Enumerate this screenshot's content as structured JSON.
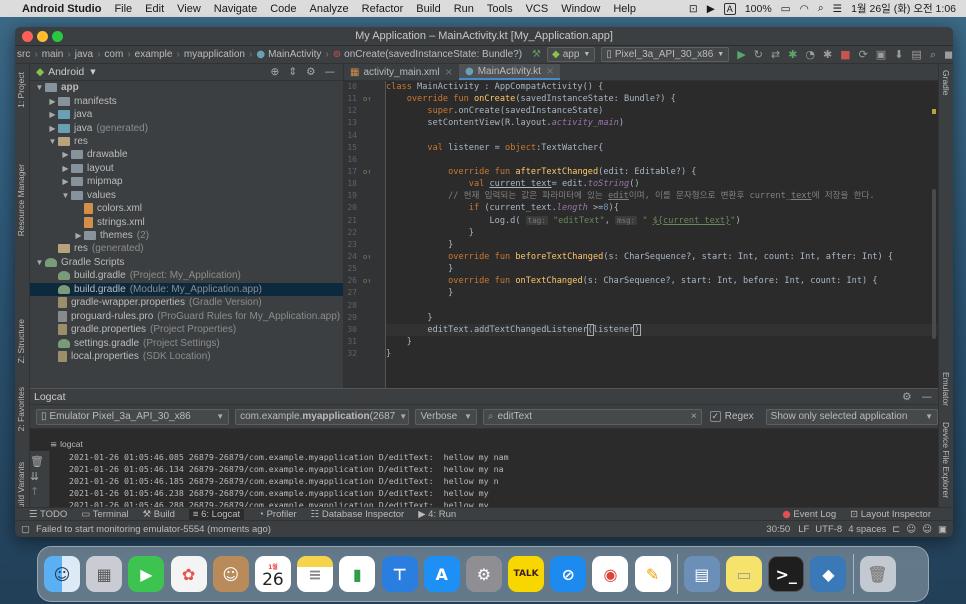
{
  "menubar": {
    "app_name": "Android Studio",
    "items": [
      "File",
      "Edit",
      "View",
      "Navigate",
      "Code",
      "Analyze",
      "Refactor",
      "Build",
      "Run",
      "Tools",
      "VCS",
      "Window",
      "Help"
    ],
    "battery": "100%",
    "keyboard": "A",
    "datetime": "1월 26일 (화) 오전 1:06"
  },
  "window": {
    "title": "My Application – MainActivity.kt [My_Application.app]"
  },
  "navbar": {
    "breadcrumbs": [
      "src",
      "main",
      "java",
      "com",
      "example",
      "myapplication",
      "MainActivity",
      "onCreate(savedInstanceState: Bundle?)"
    ],
    "run_config": "app",
    "device": "Pixel_3a_API_30_x86"
  },
  "project": {
    "view_mode": "Android",
    "tree": [
      {
        "label": "app",
        "hint": "",
        "indent": 0,
        "arrow": "▼",
        "icon": "folder",
        "color": "#87939a",
        "bold": true
      },
      {
        "label": "manifests",
        "hint": "",
        "indent": 1,
        "arrow": "▶",
        "icon": "folder",
        "color": "#87939a"
      },
      {
        "label": "java",
        "hint": "",
        "indent": 1,
        "arrow": "▶",
        "icon": "folder",
        "color": "#6a9fb5"
      },
      {
        "label": "java",
        "hint": "(generated)",
        "indent": 1,
        "arrow": "▶",
        "icon": "folder",
        "color": "#6a9fb5"
      },
      {
        "label": "res",
        "hint": "",
        "indent": 1,
        "arrow": "▼",
        "icon": "folder",
        "color": "#b8a27d"
      },
      {
        "label": "drawable",
        "hint": "",
        "indent": 2,
        "arrow": "▶",
        "icon": "folder",
        "color": "#87939a"
      },
      {
        "label": "layout",
        "hint": "",
        "indent": 2,
        "arrow": "▶",
        "icon": "folder",
        "color": "#87939a"
      },
      {
        "label": "mipmap",
        "hint": "",
        "indent": 2,
        "arrow": "▶",
        "icon": "folder",
        "color": "#87939a"
      },
      {
        "label": "values",
        "hint": "",
        "indent": 2,
        "arrow": "▼",
        "icon": "folder",
        "color": "#87939a"
      },
      {
        "label": "colors.xml",
        "hint": "",
        "indent": 3,
        "arrow": "",
        "icon": "file",
        "color": "#d38f4a"
      },
      {
        "label": "strings.xml",
        "hint": "",
        "indent": 3,
        "arrow": "",
        "icon": "file",
        "color": "#d38f4a"
      },
      {
        "label": "themes",
        "hint": "(2)",
        "indent": 3,
        "arrow": "▶",
        "icon": "folder",
        "color": "#87939a"
      },
      {
        "label": "res",
        "hint": "(generated)",
        "indent": 1,
        "arrow": "",
        "icon": "folder",
        "color": "#b8a27d"
      },
      {
        "label": "Gradle Scripts",
        "hint": "",
        "indent": 0,
        "arrow": "▼",
        "icon": "gradle",
        "color": "#7a9b7a"
      },
      {
        "label": "build.gradle",
        "hint": "(Project: My_Application)",
        "indent": 1,
        "arrow": "",
        "icon": "gradle",
        "color": "#7a9b7a"
      },
      {
        "label": "build.gradle",
        "hint": "(Module: My_Application.app)",
        "indent": 1,
        "arrow": "",
        "icon": "gradle",
        "color": "#7a9b7a",
        "selected": true
      },
      {
        "label": "gradle-wrapper.properties",
        "hint": "(Gradle Version)",
        "indent": 1,
        "arrow": "",
        "icon": "file",
        "color": "#9a8f6a"
      },
      {
        "label": "proguard-rules.pro",
        "hint": "(ProGuard Rules for My_Application.app)",
        "indent": 1,
        "arrow": "",
        "icon": "file",
        "color": "#8a8a8a"
      },
      {
        "label": "gradle.properties",
        "hint": "(Project Properties)",
        "indent": 1,
        "arrow": "",
        "icon": "file",
        "color": "#9a8f6a"
      },
      {
        "label": "settings.gradle",
        "hint": "(Project Settings)",
        "indent": 1,
        "arrow": "",
        "icon": "gradle",
        "color": "#7a9b7a"
      },
      {
        "label": "local.properties",
        "hint": "(SDK Location)",
        "indent": 1,
        "arrow": "",
        "icon": "file",
        "color": "#9a8f6a"
      }
    ]
  },
  "editor": {
    "tabs": [
      {
        "label": "activity_main.xml",
        "active": false
      },
      {
        "label": "MainActivity.kt",
        "active": true
      }
    ],
    "line_numbers": [
      "10",
      "11",
      "12",
      "13",
      "14",
      "15",
      "16",
      "17",
      "18",
      "19",
      "20",
      "21",
      "22",
      "23",
      "24",
      "25",
      "26",
      "27",
      "28",
      "29",
      "30",
      "31",
      "32"
    ]
  },
  "logcat": {
    "title": "Logcat",
    "device": "Emulator Pixel_3a_API_30_x86",
    "package_prefix": "com.example.",
    "package_bold": "myapplication",
    "package_suffix": " (2687",
    "level": "Verbose",
    "search": "editText",
    "regex_label": "Regex",
    "filter": "Show only selected application",
    "sub_label": "logcat",
    "lines": [
      "2021-01-26 01:05:46.085 26879-26879/com.example.myapplication D/editText:  hellow my nam",
      "2021-01-26 01:05:46.134 26879-26879/com.example.myapplication D/editText:  hellow my na",
      "2021-01-26 01:05:46.185 26879-26879/com.example.myapplication D/editText:  hellow my n",
      "2021-01-26 01:05:46.238 26879-26879/com.example.myapplication D/editText:  hellow my",
      "2021-01-26 01:05:46.288 26879-26879/com.example.myapplication D/editText:  hellow my",
      "2021-01-26 01:05:46.341 26879-26879/com.example.myapplication D/editText:  hellow m"
    ]
  },
  "toolwindows": {
    "bottom": [
      "TODO",
      "Terminal",
      "Build",
      "6: Logcat",
      "Profiler",
      "Database Inspector",
      "4: Run"
    ],
    "bottom_right": [
      "Event Log",
      "Layout Inspector"
    ],
    "left": [
      "1: Project",
      "Resource Manager",
      "Z: Structure",
      "2: Favorites",
      "Build Variants"
    ],
    "right": [
      "Gradle",
      "Emulator",
      "Device File Explorer"
    ]
  },
  "status": {
    "message": "Failed to start monitoring emulator-5554 (moments ago)",
    "position": "30:50",
    "line_sep": "LF",
    "encoding": "UTF-8",
    "indent": "4 spaces"
  },
  "dock": {
    "calendar_month": "1월",
    "calendar_day": "26",
    "talk_label": "TALK",
    "apps": [
      "finder-icon",
      "launchpad-icon",
      "facetime-icon",
      "photos-icon",
      "contacts-icon",
      "calendar-icon",
      "notes-icon",
      "numbers-icon",
      "keynote-icon",
      "app-store-icon",
      "system-preferences-icon",
      "kakaotalk-icon",
      "safari-icon",
      "chrome-icon",
      "pages-icon",
      "preview-icon",
      "stickies-icon",
      "terminal-icon",
      "android-studio-icon",
      "trash-icon"
    ]
  }
}
